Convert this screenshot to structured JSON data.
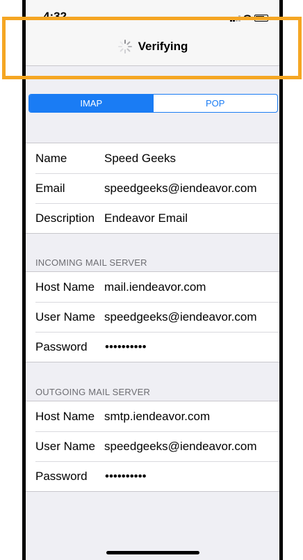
{
  "status_bar": {
    "time": "4:32",
    "icons": [
      "signal-icon",
      "wifi-icon",
      "battery-icon"
    ]
  },
  "nav": {
    "title": "Verifying",
    "spinner_icon": "activity-spinner-icon"
  },
  "segmented": {
    "options": [
      "IMAP",
      "POP"
    ],
    "selected": "IMAP"
  },
  "account": {
    "rows": [
      {
        "label": "Name",
        "value": "Speed Geeks"
      },
      {
        "label": "Email",
        "value": "speedgeeks@iendeavor.com"
      },
      {
        "label": "Description",
        "value": "Endeavor Email"
      }
    ]
  },
  "incoming": {
    "header": "INCOMING MAIL SERVER",
    "rows": [
      {
        "label": "Host Name",
        "value": "mail.iendeavor.com"
      },
      {
        "label": "User Name",
        "value": "speedgeeks@iendeavor.com"
      },
      {
        "label": "Password",
        "value": "••••••••••"
      }
    ]
  },
  "outgoing": {
    "header": "OUTGOING MAIL SERVER",
    "rows": [
      {
        "label": "Host Name",
        "value": "smtp.iendeavor.com"
      },
      {
        "label": "User Name",
        "value": "speedgeeks@iendeavor.com"
      },
      {
        "label": "Password",
        "value": "••••••••••"
      }
    ]
  },
  "colors": {
    "accent": "#1a7cf4",
    "highlight": "#f5a623",
    "background": "#efeff4"
  }
}
